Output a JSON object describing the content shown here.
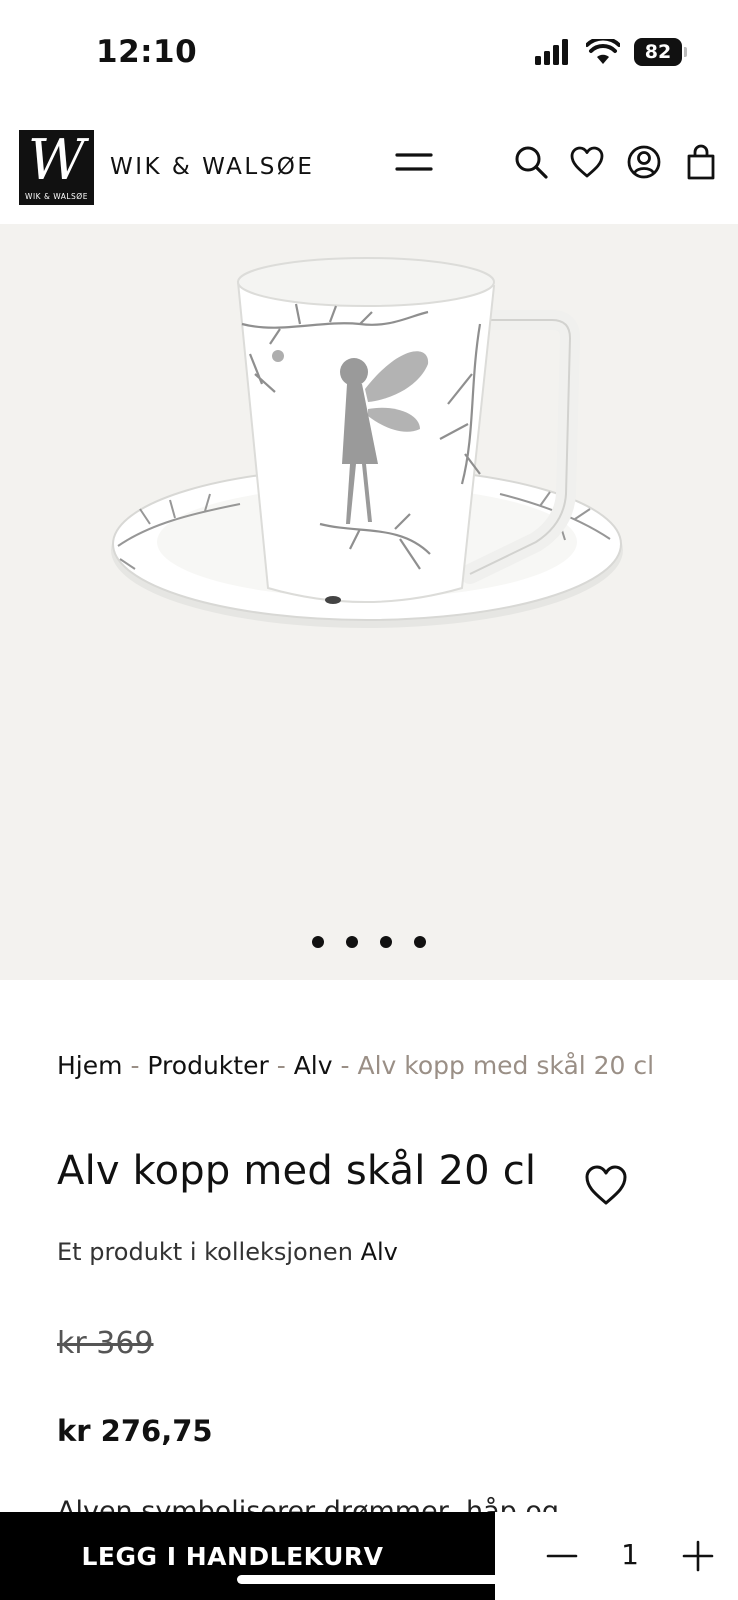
{
  "status": {
    "time": "12:10",
    "battery": "82",
    "icons": [
      "signal-icon",
      "wifi-icon",
      "battery-icon"
    ]
  },
  "header": {
    "logo_mark": "W",
    "logo_small": "WIK & WALSØE",
    "logo_text": "WIK & WALSØE",
    "icons": [
      "menu-icon",
      "search-icon",
      "heart-icon",
      "account-icon",
      "cart-icon"
    ]
  },
  "gallery": {
    "image": "cup-with-saucer-fairy-pattern",
    "dot_count": 4
  },
  "breadcrumb": {
    "home": "Hjem",
    "products": "Produkter",
    "collection": "Alv",
    "current": "Alv kopp med skål 20 cl",
    "separator": "-"
  },
  "product": {
    "title": "Alv kopp med skål 20 cl",
    "collection_prefix": "Et produkt i kolleksjonen",
    "collection_name": "Alv",
    "old_price": "kr 369",
    "price": "kr 276,75",
    "description": "Alven symboliserer drømmer, håp og"
  },
  "cart_bar": {
    "add_label": "LEGG I HANDLEKURV",
    "quantity": "1"
  },
  "colors": {
    "accent_muted": "#9a8f86",
    "gallery_bg": "#f3f2ef",
    "button_bg": "#000000"
  }
}
